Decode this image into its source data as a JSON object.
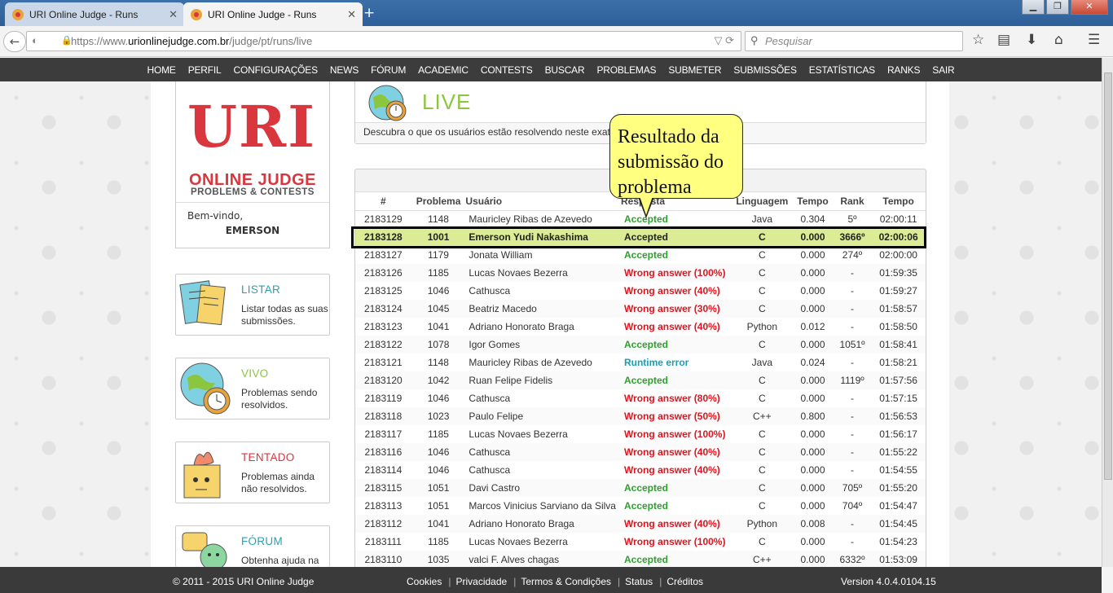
{
  "browser": {
    "tabs": [
      {
        "title": "URI Online Judge - Runs",
        "active": false
      },
      {
        "title": "URI Online Judge - Runs",
        "active": true
      }
    ],
    "url_prefix": "https://www.",
    "url_domain": "urionlinejudge.com.br",
    "url_path": "/judge/pt/runs/live",
    "search_placeholder": "Pesquisar"
  },
  "menu": [
    "HOME",
    "PERFIL",
    "CONFIGURAÇÕES",
    "NEWS",
    "FÓRUM",
    "ACADEMIC",
    "CONTESTS",
    "BUSCAR",
    "PROBLEMAS",
    "SUBMETER",
    "SUBMISSÕES",
    "ESTATÍSTICAS",
    "RANKS",
    "SAIR"
  ],
  "sidebar": {
    "logo_text": "URI",
    "online_judge": "ONLINE JUDGE",
    "problems_contests": "PROBLEMS & CONTESTS",
    "welcome": "Bem-vindo,",
    "username": "EMERSON",
    "cards": [
      {
        "title": "LISTAR",
        "desc": "Listar todas as suas submissões.",
        "color": "#2a9fb5"
      },
      {
        "title": "VIVO",
        "desc": "Problemas sendo resolvidos.",
        "color": "#8cc63f"
      },
      {
        "title": "TENTADO",
        "desc": "Problemas ainda não resolvidos.",
        "color": "#d9363e"
      },
      {
        "title": "FÓRUM",
        "desc": "Obtenha ajuda na",
        "color": "#2a9fb5"
      }
    ]
  },
  "live": {
    "title": "LIVE",
    "description": "Descubra o que os usuários estão resolvendo neste exato momento."
  },
  "callout": {
    "text": "Resultado da submissão do problema"
  },
  "table": {
    "headers": [
      "#",
      "Problema",
      "Usuário",
      "Resposta",
      "Linguagem",
      "Tempo",
      "Rank",
      "Tempo"
    ],
    "rows": [
      {
        "id": "2183129",
        "problem": "1148",
        "user": "Mauricley Ribas de Azevedo",
        "result": "Accepted",
        "status": "ok",
        "lang": "Java",
        "time": "0.304",
        "rank": "5º",
        "clock": "02:00:11"
      },
      {
        "id": "2183128",
        "problem": "1001",
        "user": "Emerson Yudi Nakashima",
        "result": "Accepted",
        "status": "ok",
        "lang": "C",
        "time": "0.000",
        "rank": "3666º",
        "clock": "02:00:06",
        "mine": true
      },
      {
        "id": "2183127",
        "problem": "1179",
        "user": "Jonata William",
        "result": "Accepted",
        "status": "ok",
        "lang": "C",
        "time": "0.000",
        "rank": "274º",
        "clock": "02:00:00"
      },
      {
        "id": "2183126",
        "problem": "1185",
        "user": "Lucas Novaes Bezerra",
        "result": "Wrong answer (100%)",
        "status": "wa",
        "lang": "C",
        "time": "0.000",
        "rank": "-",
        "clock": "01:59:35"
      },
      {
        "id": "2183125",
        "problem": "1046",
        "user": "Cathusca",
        "result": "Wrong answer (40%)",
        "status": "wa",
        "lang": "C",
        "time": "0.000",
        "rank": "-",
        "clock": "01:59:27"
      },
      {
        "id": "2183124",
        "problem": "1045",
        "user": "Beatriz Macedo",
        "result": "Wrong answer (30%)",
        "status": "wa",
        "lang": "C",
        "time": "0.000",
        "rank": "-",
        "clock": "01:58:57"
      },
      {
        "id": "2183123",
        "problem": "1041",
        "user": "Adriano Honorato Braga",
        "result": "Wrong answer (40%)",
        "status": "wa",
        "lang": "Python",
        "time": "0.012",
        "rank": "-",
        "clock": "01:58:50"
      },
      {
        "id": "2183122",
        "problem": "1078",
        "user": "Igor Gomes",
        "result": "Accepted",
        "status": "ok",
        "lang": "C",
        "time": "0.000",
        "rank": "1051º",
        "clock": "01:58:41"
      },
      {
        "id": "2183121",
        "problem": "1148",
        "user": "Mauricley Ribas de Azevedo",
        "result": "Runtime error",
        "status": "rte",
        "lang": "Java",
        "time": "0.024",
        "rank": "-",
        "clock": "01:58:21"
      },
      {
        "id": "2183120",
        "problem": "1042",
        "user": "Ruan Felipe Fidelis",
        "result": "Accepted",
        "status": "ok",
        "lang": "C",
        "time": "0.000",
        "rank": "1119º",
        "clock": "01:57:56"
      },
      {
        "id": "2183119",
        "problem": "1046",
        "user": "Cathusca",
        "result": "Wrong answer (80%)",
        "status": "wa",
        "lang": "C",
        "time": "0.000",
        "rank": "-",
        "clock": "01:57:15"
      },
      {
        "id": "2183118",
        "problem": "1023",
        "user": "Paulo Felipe",
        "result": "Wrong answer (50%)",
        "status": "wa",
        "lang": "C++",
        "time": "0.800",
        "rank": "-",
        "clock": "01:56:53"
      },
      {
        "id": "2183117",
        "problem": "1185",
        "user": "Lucas Novaes Bezerra",
        "result": "Wrong answer (100%)",
        "status": "wa",
        "lang": "C",
        "time": "0.000",
        "rank": "-",
        "clock": "01:56:17"
      },
      {
        "id": "2183116",
        "problem": "1046",
        "user": "Cathusca",
        "result": "Wrong answer (40%)",
        "status": "wa",
        "lang": "C",
        "time": "0.000",
        "rank": "-",
        "clock": "01:55:22"
      },
      {
        "id": "2183114",
        "problem": "1046",
        "user": "Cathusca",
        "result": "Wrong answer (40%)",
        "status": "wa",
        "lang": "C",
        "time": "0.000",
        "rank": "-",
        "clock": "01:54:55"
      },
      {
        "id": "2183115",
        "problem": "1051",
        "user": "Davi Castro",
        "result": "Accepted",
        "status": "ok",
        "lang": "C",
        "time": "0.000",
        "rank": "705º",
        "clock": "01:55:20"
      },
      {
        "id": "2183113",
        "problem": "1051",
        "user": "Marcos Vinicius Sarviano da Silva",
        "result": "Accepted",
        "status": "ok",
        "lang": "C",
        "time": "0.000",
        "rank": "704º",
        "clock": "01:54:47"
      },
      {
        "id": "2183112",
        "problem": "1041",
        "user": "Adriano Honorato Braga",
        "result": "Wrong answer (40%)",
        "status": "wa",
        "lang": "Python",
        "time": "0.008",
        "rank": "-",
        "clock": "01:54:45"
      },
      {
        "id": "2183111",
        "problem": "1185",
        "user": "Lucas Novaes Bezerra",
        "result": "Wrong answer (100%)",
        "status": "wa",
        "lang": "C",
        "time": "0.000",
        "rank": "-",
        "clock": "01:54:23"
      },
      {
        "id": "2183110",
        "problem": "1035",
        "user": "valci F. Alves chagas",
        "result": "Accepted",
        "status": "ok",
        "lang": "C++",
        "time": "0.000",
        "rank": "6332º",
        "clock": "01:53:09"
      }
    ]
  },
  "footer": {
    "copyright": "© 2011 - 2015 URI Online Judge",
    "links": [
      "Cookies",
      "Privacidade",
      "Termos & Condições",
      "Status",
      "Créditos"
    ],
    "version": "Version 4.0.4.0104.15"
  },
  "colors": {
    "accepted": "#2ea02e",
    "wrong": "#e0141e",
    "runtime": "#1a9fb0",
    "brand_red": "#d9363e",
    "live_green": "#8cc63f"
  }
}
